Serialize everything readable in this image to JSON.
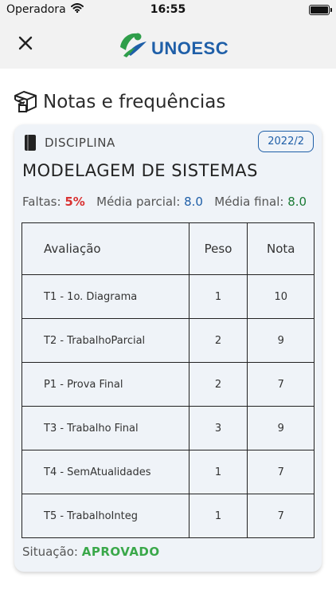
{
  "status_bar": {
    "carrier": "Operadora",
    "time": "16:55"
  },
  "header": {
    "logo_text": "UNOESC"
  },
  "page": {
    "title": "Notas e frequências"
  },
  "card": {
    "label": "DISCIPLINA",
    "year": "2022/2",
    "course_name": "MODELAGEM DE SISTEMAS",
    "stats": {
      "faltas_label": "Faltas:",
      "faltas_value": "5%",
      "media_parcial_label": "Média parcial:",
      "media_parcial_value": "8.0",
      "media_final_label": "Média final:",
      "media_final_value": "8.0"
    },
    "table": {
      "headers": [
        "Avaliação",
        "Peso",
        "Nota"
      ],
      "rows": [
        [
          "T1 - 1o. Diagrama",
          "1",
          "10"
        ],
        [
          "T2 - TrabalhoParcial",
          "2",
          "9"
        ],
        [
          "P1 - Prova Final",
          "2",
          "7"
        ],
        [
          "T3 - Trabalho Final",
          "3",
          "9"
        ],
        [
          "T4 - SemAtualidades",
          "1",
          "7"
        ],
        [
          "T5 - TrabalhoInteg",
          "1",
          "7"
        ]
      ]
    },
    "situacao_label": "Situação:",
    "situacao_value": "APROVADO"
  },
  "colors": {
    "accent": "#1f5fa8",
    "danger": "#d93232",
    "success": "#3aa84a",
    "success_dark": "#1a7a34",
    "card_bg": "#eff3f8"
  },
  "icons": [
    "wifi-icon",
    "battery-icon",
    "close-icon",
    "unoesc-logo",
    "grades-icon",
    "book-icon"
  ]
}
